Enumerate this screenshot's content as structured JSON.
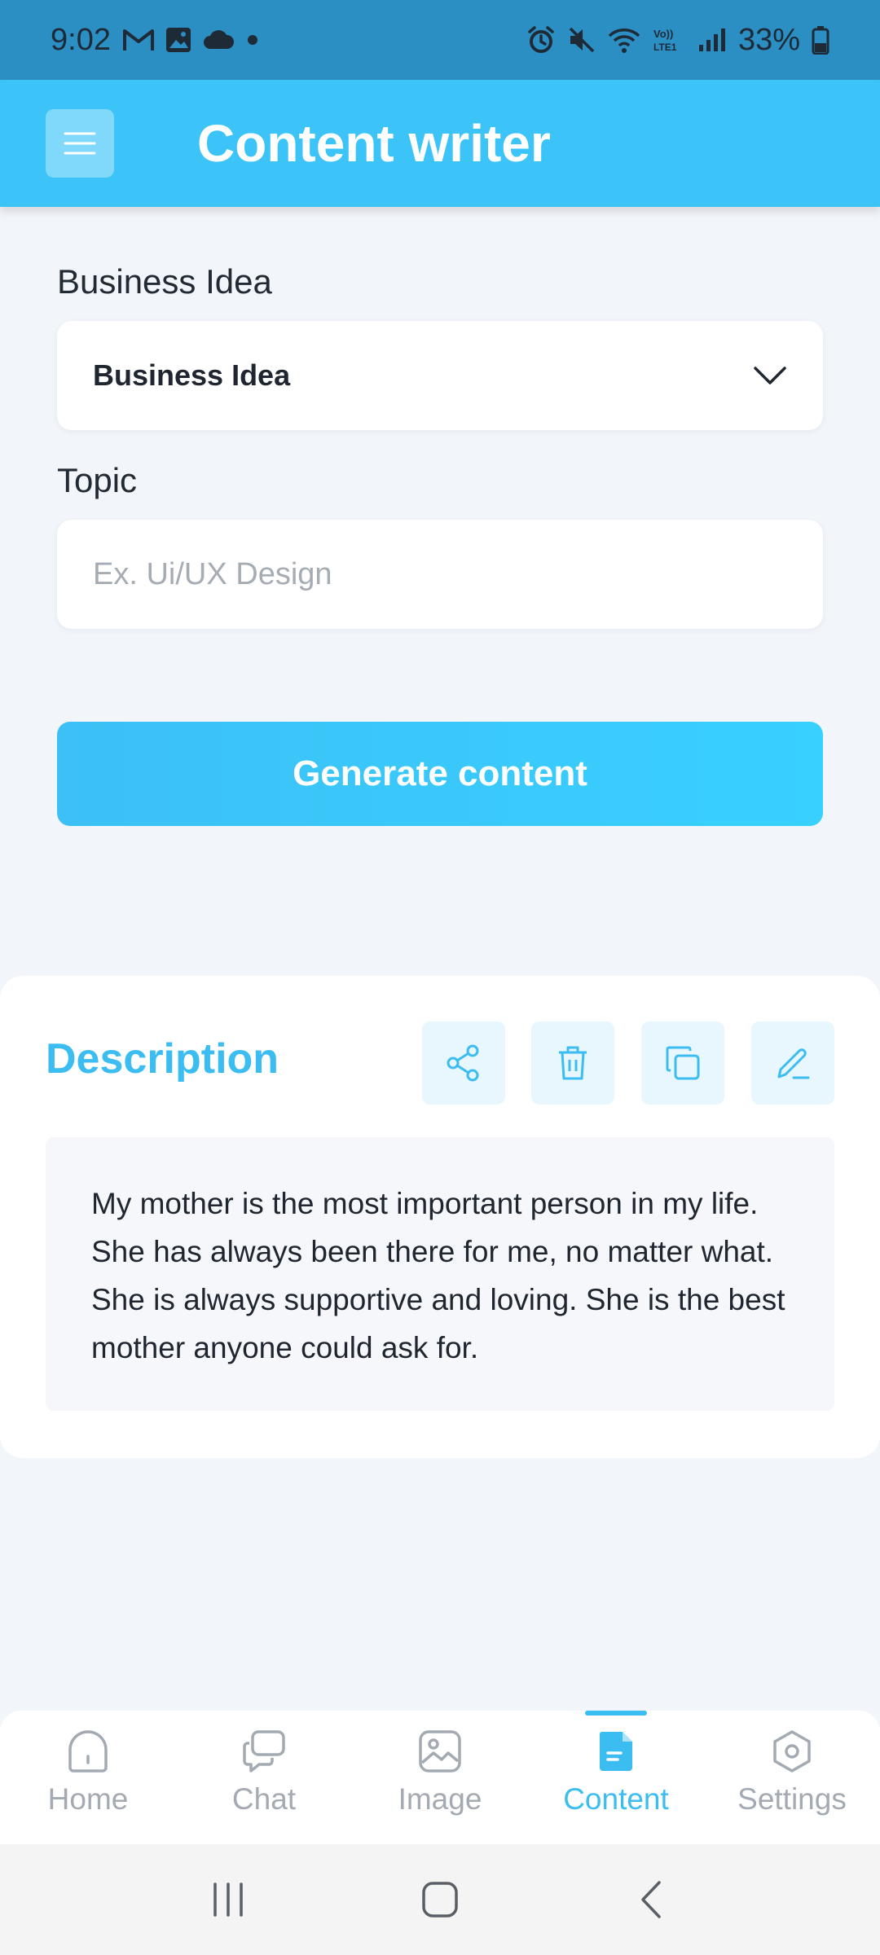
{
  "status_bar": {
    "time": "9:02",
    "battery_pct": "33%"
  },
  "app_bar": {
    "title": "Content writer"
  },
  "form": {
    "business_idea": {
      "label": "Business Idea",
      "selected": "Business Idea"
    },
    "topic": {
      "label": "Topic",
      "value": "",
      "placeholder": "Ex. Ui/UX Design"
    },
    "generate_label": "Generate content"
  },
  "description": {
    "title": "Description",
    "text": "My mother is the most important person in my life. She has always been there for me, no matter what. She is always supportive and loving. She is the best mother anyone could ask for."
  },
  "bottom_nav": {
    "items": [
      {
        "label": "Home",
        "icon": "home-icon"
      },
      {
        "label": "Chat",
        "icon": "chat-icon"
      },
      {
        "label": "Image",
        "icon": "image-icon"
      },
      {
        "label": "Content",
        "icon": "document-icon",
        "active": true
      },
      {
        "label": "Settings",
        "icon": "settings-icon"
      }
    ]
  },
  "colors": {
    "accent": "#3cbdf2",
    "app_bar": "#3cc3f8",
    "status_bar": "#2b8fc4",
    "background": "#f2f5fa"
  }
}
